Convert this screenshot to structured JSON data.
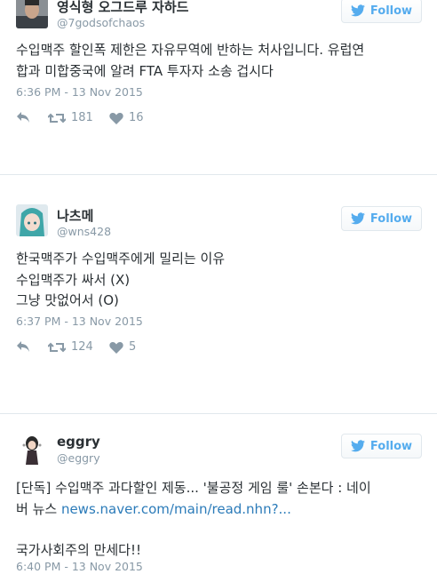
{
  "follow_label": "Follow",
  "tweets": [
    {
      "name": "영식형 오그드루 자하드",
      "handle": "@7godsofchaos",
      "lines": [
        "수입맥주 할인폭 제한은 자유무역에 반하는 처사입니다. 유럽연",
        "합과 미합중국에 알려 FTA 투자자 소송 겁시다"
      ],
      "time": "6:36 PM - 13 Nov 2015",
      "retweets": "181",
      "likes": "16"
    },
    {
      "name": "나츠메",
      "handle": "@wns428",
      "lines": [
        "한국맥주가 수입맥주에게 밀리는 이유",
        "수입맥주가 싸서 (X)",
        "그냥 맛없어서 (O)"
      ],
      "time": "6:37 PM - 13 Nov 2015",
      "retweets": "124",
      "likes": "5"
    },
    {
      "name": "eggry",
      "handle": "@eggry",
      "line1": "[단독] 수입맥주 과다할인 제동... '불공정 게임 룰' 손본다 : 네이",
      "line2_prefix": "버 뉴스 ",
      "link": "news.naver.com/main/read.nhn?...",
      "line3": "국가사회주의 만세다!!",
      "time": "6:40 PM - 13 Nov 2015"
    }
  ],
  "colors": {
    "accent": "#55acee",
    "muted": "#8899a6",
    "text": "#292f33",
    "link": "#2b7bb9"
  }
}
